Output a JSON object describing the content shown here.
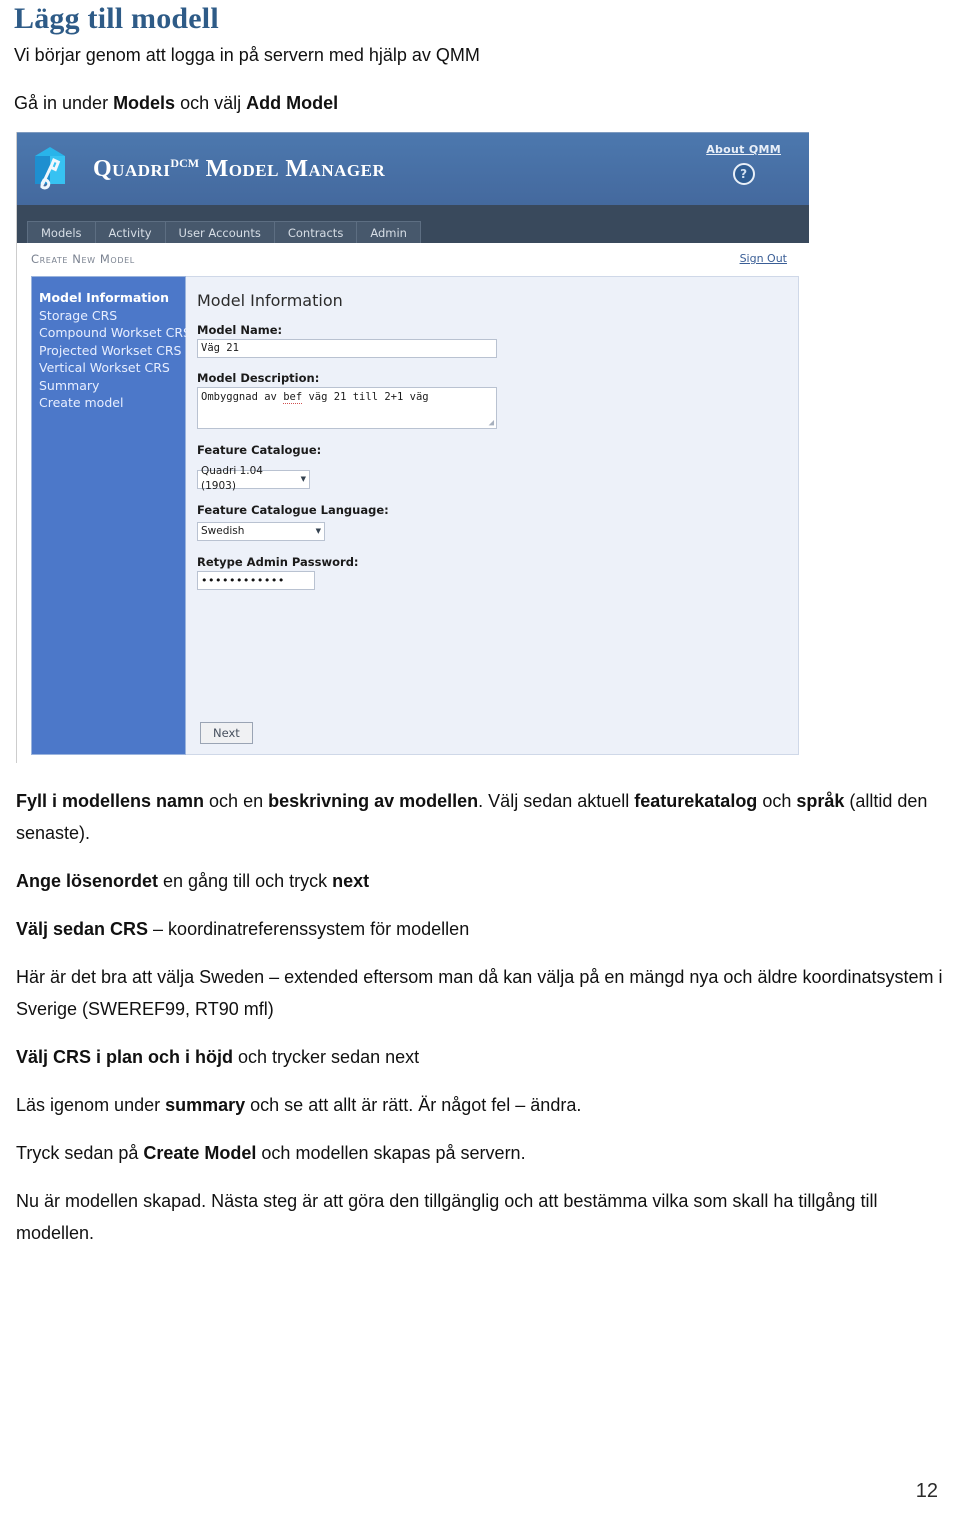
{
  "document": {
    "title": "Lägg till modell",
    "intro_line_1": "Vi börjar genom att logga in på servern med hjälp av QMM",
    "intro_line_2_pre": "Gå in under ",
    "intro_line_2_b1": "Models",
    "intro_line_2_mid": " och välj ",
    "intro_line_2_b2": "Add Model",
    "page_number": "12"
  },
  "screenshot": {
    "header": {
      "brand_main": "Quadri",
      "brand_sup": "DCM",
      "brand_rest": " Model Manager",
      "about_link": "About QMM",
      "help_glyph": "?"
    },
    "tabs": [
      {
        "label": "Models"
      },
      {
        "label": "Activity"
      },
      {
        "label": "User Accounts"
      },
      {
        "label": "Contracts"
      },
      {
        "label": "Admin"
      }
    ],
    "subbar": {
      "breadcrumb": "Create New Model",
      "sign_out": "Sign Out"
    },
    "wizard_steps": [
      {
        "label": "Model Information",
        "active": true
      },
      {
        "label": "Storage CRS",
        "active": false
      },
      {
        "label": "Compound Workset CRS",
        "active": false
      },
      {
        "label": "Projected Workset CRS",
        "active": false
      },
      {
        "label": "Vertical Workset CRS",
        "active": false
      },
      {
        "label": "Summary",
        "active": false
      },
      {
        "label": "Create model",
        "active": false
      }
    ],
    "form": {
      "title": "Model Information",
      "model_name_label": "Model Name:",
      "model_name_value": "Väg 21",
      "model_description_label": "Model Description:",
      "model_description_pre": "Ombyggnad av ",
      "model_description_mis": "bef",
      "model_description_post": " väg 21 till 2+1 väg",
      "feature_catalogue_label": "Feature Catalogue:",
      "feature_catalogue_value": "Quadri 1.04 (1903)",
      "feature_catalogue_language_label": "Feature Catalogue Language:",
      "feature_catalogue_language_value": "Swedish",
      "retype_password_label": "Retype Admin Password:",
      "retype_password_value": "••••••••••••",
      "next_button": "Next",
      "dropdown_arrow": "▼",
      "resize_grip": "◢"
    },
    "colors": {
      "header_blue": "#4C78AE",
      "navbar_dark": "#39495C",
      "wizard_blue": "#4C78C9",
      "panel_light": "#EDF1F9"
    }
  },
  "body_copy": {
    "p1_b1": "Fyll i modellens namn",
    "p1_t1": " och en ",
    "p1_b2": "beskrivning av modellen",
    "p1_t2": ". Välj sedan aktuell ",
    "p1_b3": "featurekatalog",
    "p1_t3": " och ",
    "p1_b4": "språk",
    "p1_t4": " (alltid den senaste).",
    "p2_b1": "Ange lösenordet",
    "p2_t1": " en gång till och tryck ",
    "p2_b2": "next",
    "p3_b1": "Välj sedan CRS",
    "p3_t1": " – koordinatreferenssystem för modellen",
    "p4_t1": "Här är det bra att välja Sweden – extended eftersom man då kan välja på en mängd nya och äldre koordinatsystem i Sverige (SWEREF99, RT90 mfl)",
    "p5_b1": "Välj CRS i plan och i höjd",
    "p5_t1": " och trycker sedan next",
    "p6_t1": "Läs igenom under ",
    "p6_b1": "summary",
    "p6_t2": " och se att allt är rätt. Är något fel – ändra.",
    "p7_t1": "Tryck sedan på ",
    "p7_b1": "Create Model",
    "p7_t2": " och modellen skapas på servern.",
    "p8_t1": "Nu är modellen skapad. Nästa steg är att göra den tillgänglig och att bestämma vilka som skall ha tillgång till modellen."
  }
}
